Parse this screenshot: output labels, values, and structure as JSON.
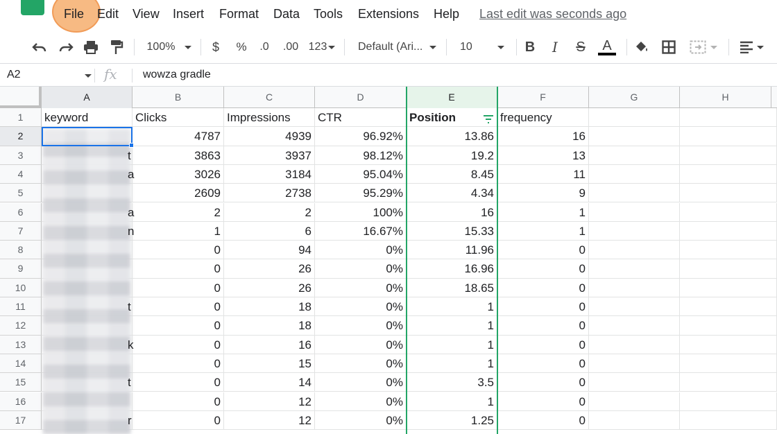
{
  "menu": {
    "items": [
      "File",
      "Edit",
      "View",
      "Insert",
      "Format",
      "Data",
      "Tools",
      "Extensions",
      "Help"
    ],
    "last_edit": "Last edit was seconds ago"
  },
  "toolbar": {
    "zoom": "100%",
    "currency": "$",
    "percent": "%",
    "decrease_decimal": ".0",
    "increase_decimal": ".00",
    "number_format": "123",
    "font": "Default (Ari...",
    "font_size": "10",
    "bold": "B",
    "italic": "I",
    "strike": "S",
    "text_color": "A"
  },
  "formula_bar": {
    "cell_ref": "A2",
    "fx": "fx",
    "value": "wowza gradle"
  },
  "columns": [
    "A",
    "B",
    "C",
    "D",
    "E",
    "F",
    "G",
    "H"
  ],
  "header_row": [
    "keyword",
    "Clicks",
    "Impressions",
    "CTR",
    "Position",
    "frequency"
  ],
  "rows": [
    {
      "n": "1"
    },
    {
      "n": "2",
      "b": "4787",
      "c": "4939",
      "d": "96.92%",
      "e": "13.86",
      "f": "16",
      "edge": ""
    },
    {
      "n": "3",
      "b": "3863",
      "c": "3937",
      "d": "98.12%",
      "e": "19.2",
      "f": "13",
      "edge": "t"
    },
    {
      "n": "4",
      "b": "3026",
      "c": "3184",
      "d": "95.04%",
      "e": "8.45",
      "f": "11",
      "edge": "a"
    },
    {
      "n": "5",
      "b": "2609",
      "c": "2738",
      "d": "95.29%",
      "e": "4.34",
      "f": "9",
      "edge": ""
    },
    {
      "n": "6",
      "b": "2",
      "c": "2",
      "d": "100%",
      "e": "16",
      "f": "1",
      "edge": "a"
    },
    {
      "n": "7",
      "b": "1",
      "c": "6",
      "d": "16.67%",
      "e": "15.33",
      "f": "1",
      "edge": "n"
    },
    {
      "n": "8",
      "b": "0",
      "c": "94",
      "d": "0%",
      "e": "11.96",
      "f": "0",
      "edge": ""
    },
    {
      "n": "9",
      "b": "0",
      "c": "26",
      "d": "0%",
      "e": "16.96",
      "f": "0",
      "edge": ""
    },
    {
      "n": "10",
      "b": "0",
      "c": "26",
      "d": "0%",
      "e": "18.65",
      "f": "0",
      "edge": ""
    },
    {
      "n": "11",
      "b": "0",
      "c": "18",
      "d": "0%",
      "e": "1",
      "f": "0",
      "edge": "t"
    },
    {
      "n": "12",
      "b": "0",
      "c": "18",
      "d": "0%",
      "e": "1",
      "f": "0",
      "edge": ""
    },
    {
      "n": "13",
      "b": "0",
      "c": "16",
      "d": "0%",
      "e": "1",
      "f": "0",
      "edge": "k"
    },
    {
      "n": "14",
      "b": "0",
      "c": "15",
      "d": "0%",
      "e": "1",
      "f": "0",
      "edge": ""
    },
    {
      "n": "15",
      "b": "0",
      "c": "14",
      "d": "0%",
      "e": "3.5",
      "f": "0",
      "edge": "t"
    },
    {
      "n": "16",
      "b": "0",
      "c": "12",
      "d": "0%",
      "e": "1",
      "f": "0",
      "edge": ""
    },
    {
      "n": "17",
      "b": "0",
      "c": "12",
      "d": "0%",
      "e": "1.25",
      "f": "0",
      "edge": "r"
    }
  ],
  "colors": {
    "accent": "#1a73e8",
    "filter_green": "#23a566",
    "highlight": "#f5a660"
  }
}
